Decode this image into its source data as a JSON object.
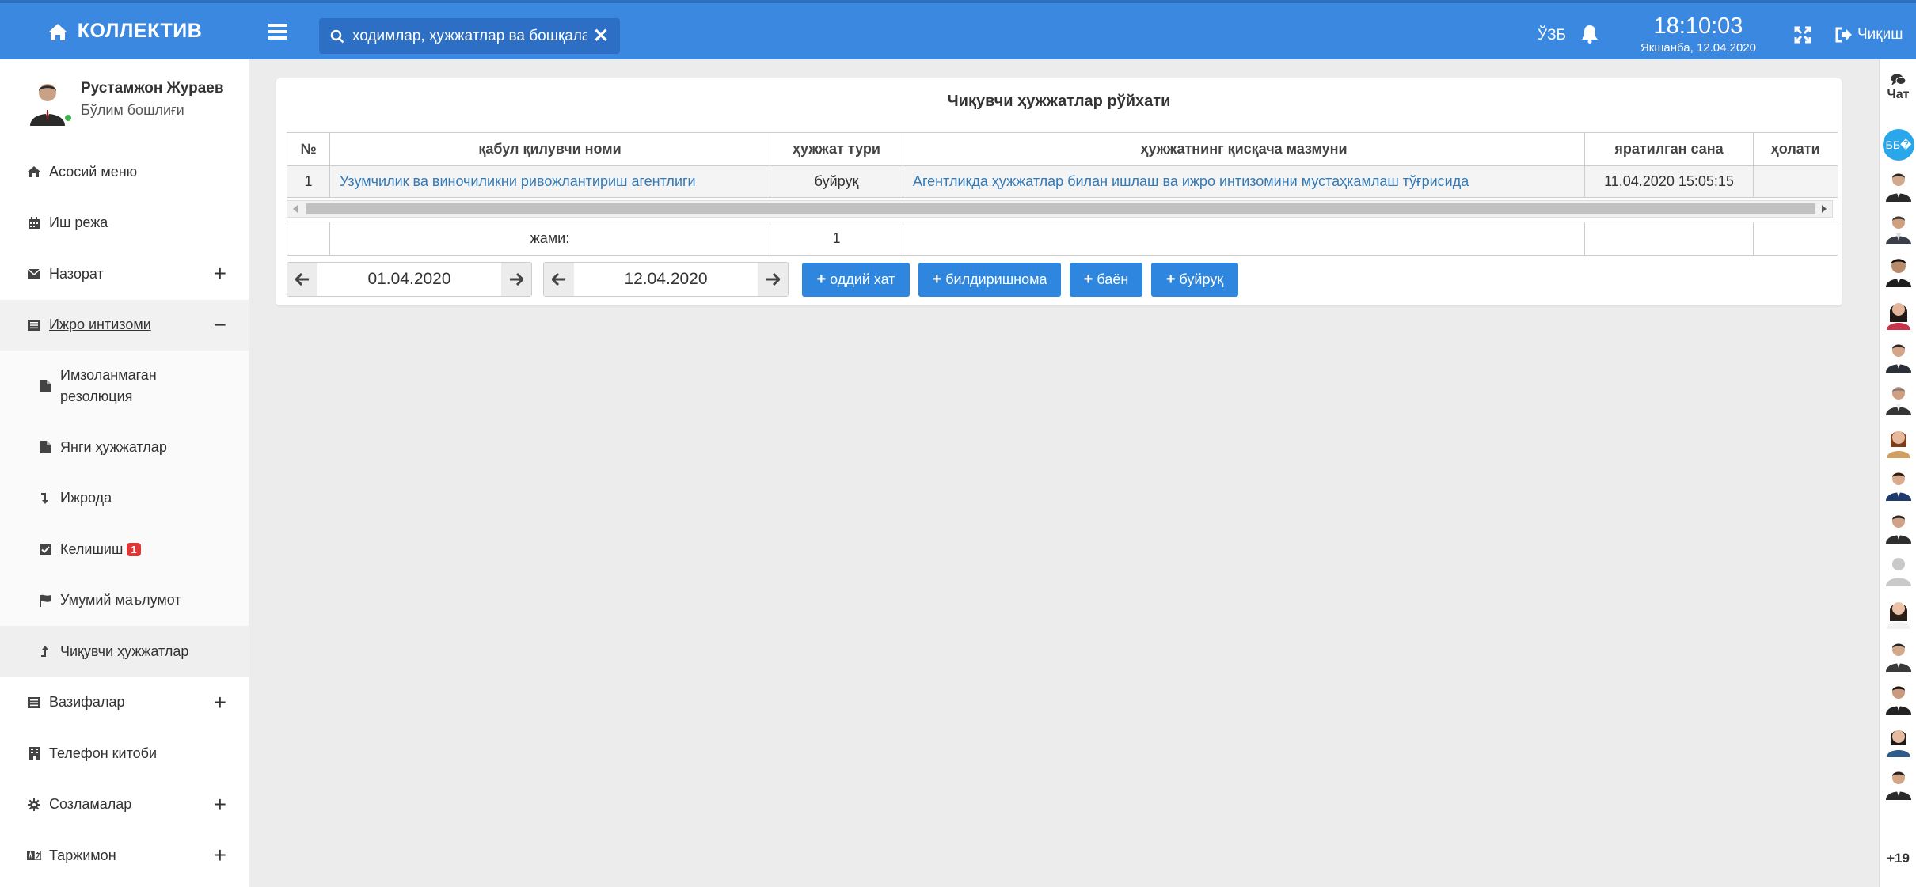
{
  "app": {
    "brand": "КОЛЛЕКТИВ"
  },
  "header": {
    "search_placeholder": "ходимлар, ҳужжатлар ва бошқаларн",
    "close_label": "✕",
    "lang": "ЎЗБ",
    "time": "18:10:03",
    "date": "Якшанба, 12.04.2020",
    "logout_label": "Чиқиш"
  },
  "user": {
    "name": "Рустамжон Жураев",
    "role": "Бўлим бошлиғи"
  },
  "sidebar": {
    "main_menu": "Асосий меню",
    "work_schedule": "Иш режа",
    "control": "Назорат",
    "execution": "Ижро интизоми",
    "unsigned": "Имзоланмаган резолюция",
    "new_docs": "Янги ҳужжатлар",
    "in_execution": "Ижрода",
    "agreement": "Келишиш",
    "agreement_badge": "1",
    "general_info": "Умумий маълумот",
    "outgoing": "Чиқувчи ҳужжатлар",
    "tasks": "Вазифалар",
    "phonebook": "Телефон китоби",
    "settings": "Созламалар",
    "translator": "Таржимон",
    "plus": "+",
    "minus": "−"
  },
  "main": {
    "title": "Чиқувчи ҳужжатлар рўйхати",
    "columns": [
      "№",
      "қабул қилувчи номи",
      "ҳужжат тури",
      "ҳужжатнинг қисқача мазмуни",
      "яратилган сана",
      "ҳолати"
    ],
    "rows": [
      [
        "1",
        "Узумчилик ва виночиликни ривожлантириш агентлиги",
        "буйруқ",
        "Агентликда ҳужжатлар билан ишлаш ва ижро интизомини мустаҳкамлаш тўғрисида",
        "11.04.2020 15:05:15",
        ""
      ]
    ],
    "total_label": "жами:",
    "total_value": "1",
    "date_from": "01.04.2020",
    "date_to": "12.04.2020",
    "buttons": {
      "plain_letter": "оддий хат",
      "memo": "билдиришнома",
      "statement": "баён",
      "order": "буйруқ"
    }
  },
  "rail": {
    "chat_label": "Чат",
    "bb_label": "ББ�",
    "more_label": "+19"
  },
  "colors": {
    "topbar": "#3b88e0",
    "accent": "#2e86de",
    "link": "#337ab7",
    "badge": "#e03636"
  }
}
